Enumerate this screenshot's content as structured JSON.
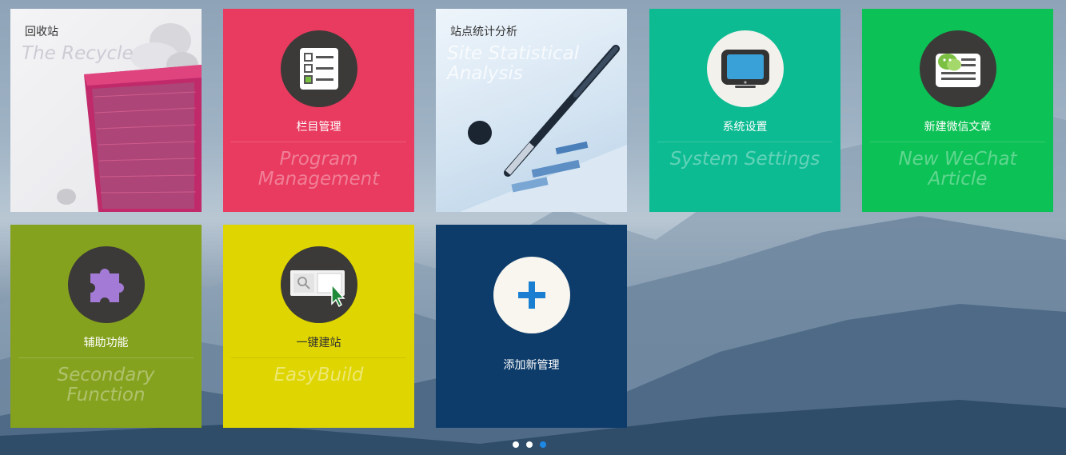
{
  "tiles": {
    "recycle": {
      "title": "回收站",
      "subtitle": "The Recycle"
    },
    "program": {
      "title": "栏目管理",
      "subtitle": "Program Management",
      "color": "#e93a5f"
    },
    "stats": {
      "title": "站点统计分析",
      "subtitle": "Site Statistical\nAnalysis"
    },
    "settings": {
      "title": "系统设置",
      "subtitle": "System Settings",
      "color": "#0dbb92"
    },
    "wechat": {
      "title": "新建微信文章",
      "subtitle": "New WeChat Article",
      "color": "#0cc155"
    },
    "secondary": {
      "title": "辅助功能",
      "subtitle": "Secondary Function",
      "color": "#85a21e"
    },
    "easybuild": {
      "title": "一键建站",
      "subtitle": "EasyBuild",
      "color": "#dfd500"
    },
    "add": {
      "title": "添加新管理",
      "color": "#0d3c6b"
    }
  },
  "icons": {
    "recycle": "trash-bin-photo",
    "program": "checklist-icon",
    "stats": "pen-chart-photo",
    "settings": "monitor-icon",
    "wechat": "wechat-article-icon",
    "secondary": "puzzle-icon",
    "easybuild": "browser-cursor-icon",
    "add": "plus-icon"
  },
  "pagination": {
    "total": 3,
    "active": 3
  }
}
